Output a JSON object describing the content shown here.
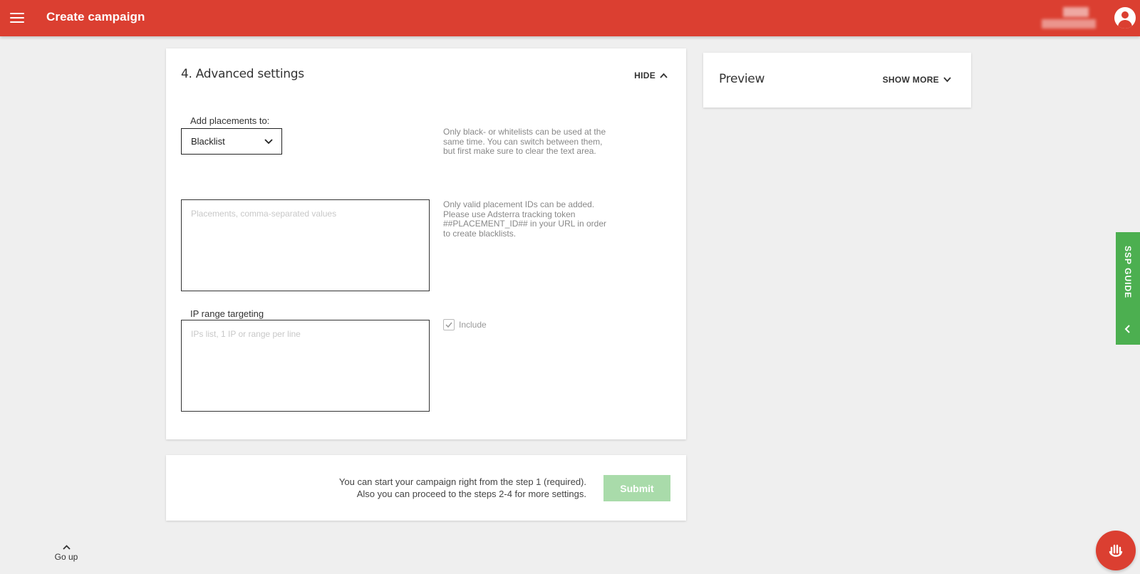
{
  "header": {
    "title": "Create campaign",
    "menu_icon": "hamburger-menu-icon",
    "avatar_icon": "account-circle-icon",
    "bar_color": "#db3f31"
  },
  "advanced": {
    "title": "4. Advanced settings",
    "toggle_label": "HIDE",
    "placements_label": "Add placements to:",
    "placements_select_value": "Blacklist",
    "placements_help": "Only black- or whitelists can be used at the same time. You can switch between them, but first make sure to clear the text area.",
    "placements_textarea_placeholder": "Placements, comma-separated values",
    "placements_textarea_help": "Only valid placement IDs can be added. Please use Adsterra tracking token ##PLACEMENT_ID## in your URL in order to create blacklists.",
    "ip_label": "IP range targeting",
    "ip_textarea_placeholder": "IPs list, 1 IP or range per line",
    "include_label": "Include",
    "include_checked": true
  },
  "preview": {
    "title": "Preview",
    "toggle_label": "SHOW MORE"
  },
  "submit_panel": {
    "note_line1": "You can start your campaign right from the step 1 (required).",
    "note_line2": "Also you can proceed to the steps 2-4 for more settings.",
    "submit_label": "Submit",
    "submit_color": "#a9dbaa"
  },
  "side_tab": {
    "label": "SSP GUIDE",
    "color": "#4caf50"
  },
  "footer": {
    "go_up_label": "Go up"
  },
  "chat": {
    "icon": "hand-wave-icon"
  }
}
